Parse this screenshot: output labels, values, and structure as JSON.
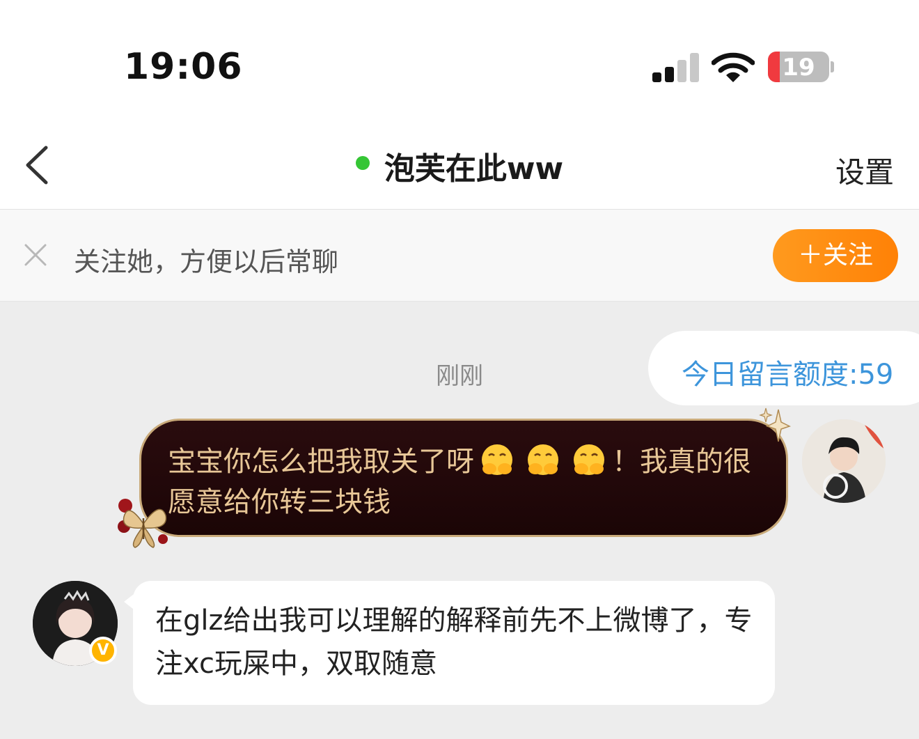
{
  "status_bar": {
    "time": "19:06",
    "battery_level": "19"
  },
  "nav": {
    "title": "泡芙在此ww",
    "settings_label": "设置",
    "online": true
  },
  "follow_banner": {
    "text": "关注她，方便以后常聊",
    "button_label": "＋关注"
  },
  "chat": {
    "quota_label": "今日留言额度:59",
    "timestamp": "刚刚",
    "outgoing_message": {
      "part1": "宝宝你怎么把我取关了呀",
      "emoji": "face-with-open-eyes-and-hand-over-mouth",
      "emoji_count": 3,
      "part2": "！我真的很愿意给你转三块钱"
    },
    "incoming_message": "在glz给出我可以理解的解释前先不上微博了，专注xc玩屎中，双取随意",
    "verified_badge": "V"
  },
  "colors": {
    "accent_orange": "#ff8a10",
    "link_blue": "#3d95db",
    "online_green": "#35c635",
    "bubble_dark": "#1e0607",
    "bubble_text_gold": "#e8c797"
  }
}
